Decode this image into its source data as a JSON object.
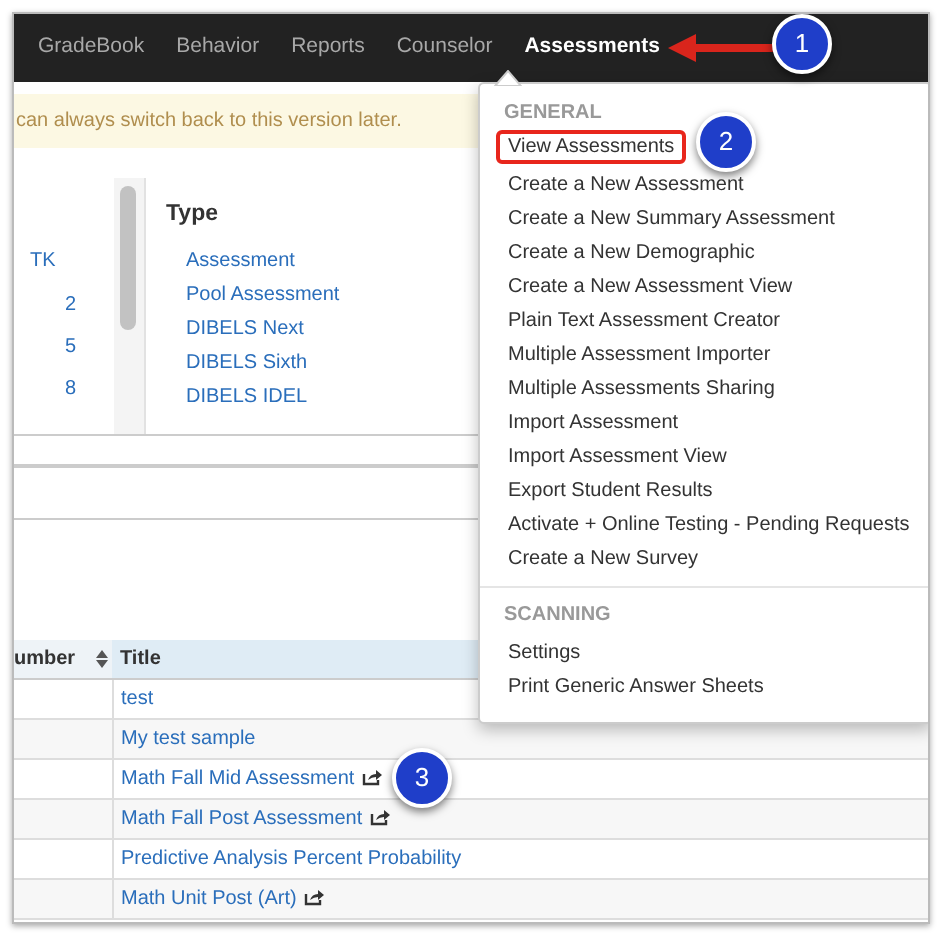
{
  "navbar": {
    "items": [
      {
        "label": "GradeBook",
        "selected": false
      },
      {
        "label": "Behavior",
        "selected": false
      },
      {
        "label": "Reports",
        "selected": false
      },
      {
        "label": "Counselor",
        "selected": false
      },
      {
        "label": "Assessments",
        "selected": true
      }
    ]
  },
  "notice": "can always switch back to this version later.",
  "grade_column": {
    "header": "TK",
    "values": [
      "2",
      "5",
      "8"
    ]
  },
  "type_panel": {
    "title": "Type",
    "items": [
      "Assessment",
      "Pool Assessment",
      "DIBELS Next",
      "DIBELS Sixth",
      "DIBELS IDEL"
    ]
  },
  "dropdown": {
    "sections": [
      {
        "header": "GENERAL",
        "items": [
          {
            "label": "View Assessments",
            "highlighted": true
          },
          {
            "label": "Create a New Assessment",
            "highlighted": false
          },
          {
            "label": "Create a New Summary Assessment",
            "highlighted": false
          },
          {
            "label": "Create a New Demographic",
            "highlighted": false
          },
          {
            "label": "Create a New Assessment View",
            "highlighted": false
          },
          {
            "label": "Plain Text Assessment Creator",
            "highlighted": false
          },
          {
            "label": "Multiple Assessment Importer",
            "highlighted": false
          },
          {
            "label": "Multiple Assessments Sharing",
            "highlighted": false
          },
          {
            "label": "Import Assessment",
            "highlighted": false
          },
          {
            "label": "Import Assessment View",
            "highlighted": false
          },
          {
            "label": "Export Student Results",
            "highlighted": false
          },
          {
            "label": "Activate + Online Testing - Pending Requests",
            "highlighted": false
          },
          {
            "label": "Create a New Survey",
            "highlighted": false
          }
        ]
      },
      {
        "header": "SCANNING",
        "items": [
          {
            "label": "Settings",
            "highlighted": false
          },
          {
            "label": "Print Generic Answer Sheets",
            "highlighted": false
          }
        ]
      }
    ]
  },
  "table": {
    "columns": [
      "umber",
      "Title"
    ],
    "rows": [
      {
        "title": "test",
        "shared": false
      },
      {
        "title": "My test sample",
        "shared": false
      },
      {
        "title": "Math Fall Mid Assessment",
        "shared": true
      },
      {
        "title": "Math Fall Post Assessment",
        "shared": true
      },
      {
        "title": "Predictive Analysis Percent Probability",
        "shared": false
      },
      {
        "title": "Math Unit Post (Art)",
        "shared": true
      }
    ]
  },
  "callouts": [
    "1",
    "2",
    "3"
  ]
}
